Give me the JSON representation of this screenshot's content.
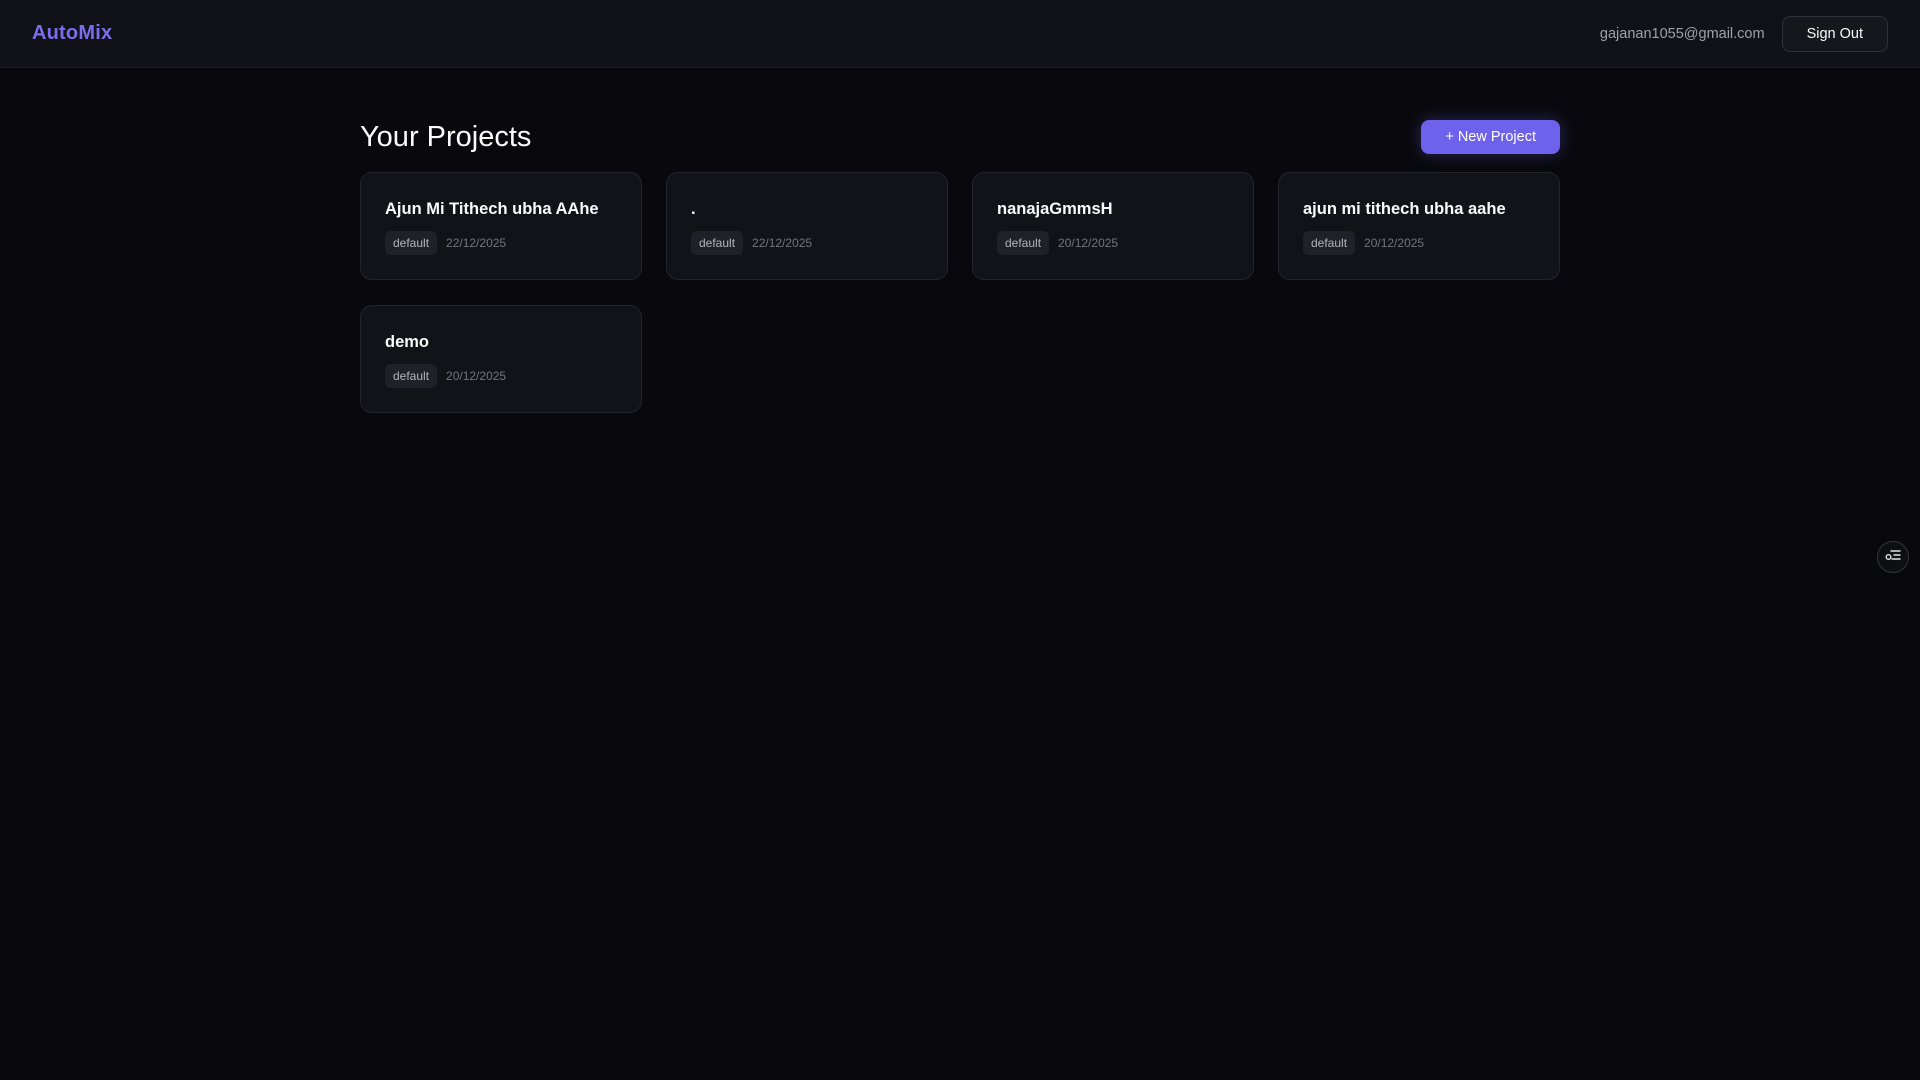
{
  "header": {
    "logo": "AutoMix",
    "user_email": "gajanan1055@gmail.com",
    "sign_out_label": "Sign Out"
  },
  "main": {
    "title": "Your Projects",
    "new_project_label": "+ New Project"
  },
  "projects": [
    {
      "name": "Ajun Mi Tithech ubha AAhe",
      "tag": "default",
      "date": "22/12/2025"
    },
    {
      "name": ".",
      "tag": "default",
      "date": "22/12/2025"
    },
    {
      "name": "nanajaGmmsH",
      "tag": "default",
      "date": "20/12/2025"
    },
    {
      "name": "ajun mi tithech ubha aahe",
      "tag": "default",
      "date": "20/12/2025"
    },
    {
      "name": "demo",
      "tag": "default",
      "date": "20/12/2025"
    }
  ],
  "floating": {
    "icon": "settings-toggle-icon"
  },
  "colors": {
    "accent": "#6e62ec",
    "logo": "#7b6cf0",
    "background": "#09090d"
  }
}
